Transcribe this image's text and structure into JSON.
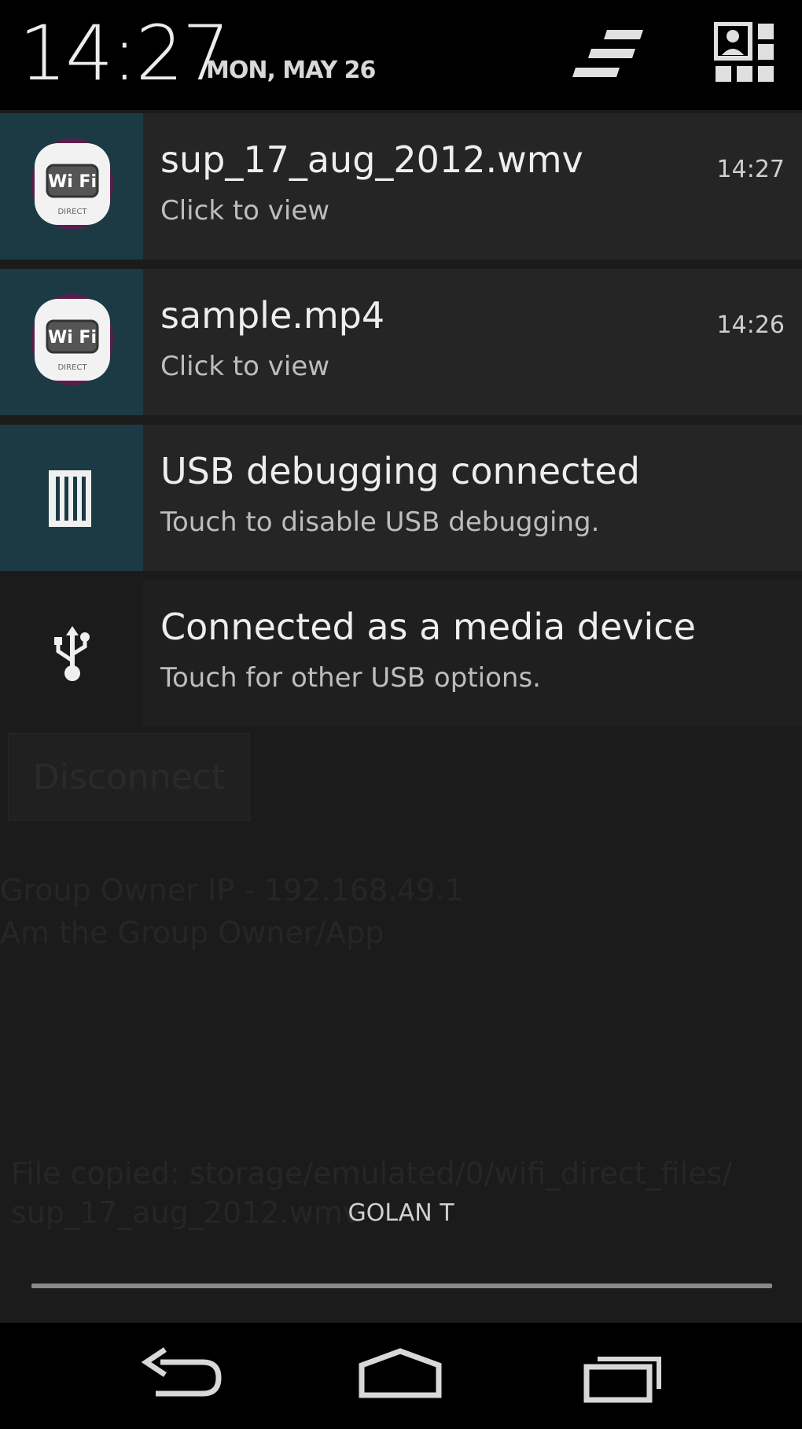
{
  "header": {
    "time": "14:27",
    "date": "MON, MAY 26",
    "icons": [
      "settings-toggle-icon",
      "quick-settings-icon"
    ]
  },
  "notifications": [
    {
      "title": "sup_17_aug_2012.wmv",
      "subtitle": "Click to view",
      "time": "14:27",
      "icon": "wifi-direct-app-icon"
    },
    {
      "title": "sample.mp4",
      "subtitle": "Click to view",
      "time": "14:26",
      "icon": "wifi-direct-app-icon"
    },
    {
      "title": "USB debugging connected",
      "subtitle": "Touch to disable USB debugging.",
      "icon": "usb-debug-icon"
    },
    {
      "title": "Connected as a media device",
      "subtitle": "Touch for other USB options.",
      "icon": "usb-icon"
    }
  ],
  "background_app": {
    "disconnect_label": "Disconnect",
    "line1": "Group Owner IP - 192.168.49.1",
    "line2": "Am the Group Owner/App",
    "line3": "File copied: storage/emulated/0/wifi_direct_files/",
    "line4": "sup_17_aug_2012.wmv"
  },
  "carrier": "GOLAN T",
  "navbar": {
    "icons": [
      "back-icon",
      "home-icon",
      "recents-icon"
    ]
  },
  "colors": {
    "header_bg": "#000000",
    "notif_bg": "#252525",
    "icon_teal": "#1c3a44",
    "panel_bg": "#1b1b1b"
  }
}
